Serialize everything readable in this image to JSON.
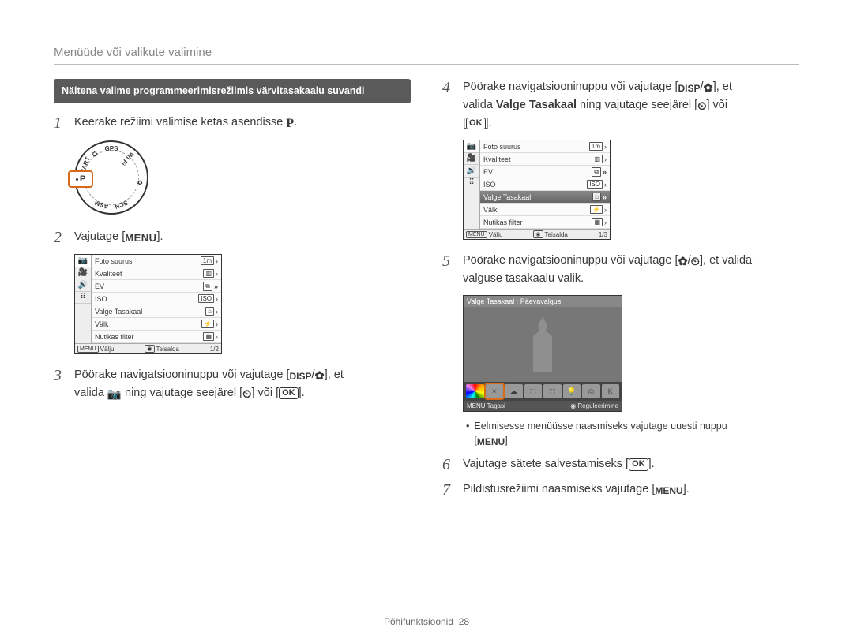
{
  "header": {
    "title": "Menüüde või valikute valimine"
  },
  "note": "Näitena valime programmeerimisrežiimis värvitasakaalu suvandi",
  "steps": {
    "s1": {
      "num": "1",
      "text_before": "Keerake režiimi valimise ketas asendisse ",
      "glyph": "P",
      "text_after": "."
    },
    "s2": {
      "num": "2",
      "text_before": "Vajutage [",
      "glyph": "MENU",
      "text_after": "]."
    },
    "s3": {
      "num": "3",
      "line1_a": "Pöörake navigatsiooninuppu või vajutage [",
      "g1": "DISP",
      "sep1": "/",
      "g2": "✿",
      "line1_b": "], et",
      "line2_a": "valida ",
      "g3": "📷",
      "line2_b": " ning vajutage seejärel [",
      "g4": "⏲",
      "line2_c": "] või [",
      "g5": "OK",
      "line2_d": "]."
    },
    "s4": {
      "num": "4",
      "line1_a": "Pöörake navigatsiooninuppu või vajutage [",
      "g1": "DISP",
      "sep1": "/",
      "g2": "✿",
      "line1_b": "], et",
      "line2_a": "valida ",
      "bold": "Valge Tasakaal",
      "line2_b": " ning vajutage seejärel [",
      "g3": "⏲",
      "line2_c": "] või",
      "line3_a": "[",
      "g4": "OK",
      "line3_b": "]."
    },
    "s5": {
      "num": "5",
      "line1_a": "Pöörake navigatsiooninuppu või vajutage [",
      "g1": "✿",
      "sep1": "/",
      "g2": "⏲",
      "line1_b": "], et valida",
      "line2": "valguse tasakaalu valik."
    },
    "s6": {
      "num": "6",
      "text_before": "Vajutage sätete salvestamiseks [",
      "glyph": "OK",
      "text_after": "]."
    },
    "s7": {
      "num": "7",
      "text_before": "Pildistusrežiimi naasmiseks vajutage [",
      "glyph": "MENU",
      "text_after": "]."
    }
  },
  "sub_bullet": {
    "text_before": "Eelmisesse menüüsse naasmiseks vajutage uuesti nuppu",
    "line2_a": "[",
    "glyph": "MENU",
    "line2_b": "]."
  },
  "dial": {
    "labels": [
      "SMART",
      "⛭",
      "GPS",
      "Wi-Fi",
      "✿",
      "SCN",
      "ASM"
    ]
  },
  "menu1": {
    "rows": [
      {
        "label": "Foto suurus",
        "icon": "1m",
        "arrow": "›"
      },
      {
        "label": "Kvaliteet",
        "icon": "▥",
        "arrow": "›"
      },
      {
        "label": "EV",
        "icon": "⧉",
        "arrow": "»",
        "big": true
      },
      {
        "label": "ISO",
        "icon": "ISO",
        "arrow": "›"
      },
      {
        "label": "Valge Tasakaal",
        "icon": "⌂",
        "arrow": "›"
      },
      {
        "label": "Välk",
        "icon": "⚡",
        "arrow": "›"
      },
      {
        "label": "Nutikas filter",
        "icon": "▦",
        "arrow": "›"
      }
    ],
    "sel_index": -1,
    "foot_left_btn": "MENU",
    "foot_left": "Välju",
    "foot_right_btn": "◉",
    "foot_right": "Teisalda",
    "page": "1/2"
  },
  "menu2": {
    "rows": [
      {
        "label": "Foto suurus",
        "icon": "1m",
        "arrow": "›"
      },
      {
        "label": "Kvaliteet",
        "icon": "▥",
        "arrow": "›"
      },
      {
        "label": "EV",
        "icon": "⧉",
        "arrow": "»",
        "big": true
      },
      {
        "label": "ISO",
        "icon": "ISO",
        "arrow": "›"
      },
      {
        "label": "Valge Tasakaal",
        "icon": "⌂",
        "arrow": "»",
        "big": true,
        "sel": true
      },
      {
        "label": "Välk",
        "icon": "⚡",
        "arrow": "›"
      },
      {
        "label": "Nutikas filter",
        "icon": "▦",
        "arrow": "›"
      }
    ],
    "foot_left_btn": "MENU",
    "foot_left": "Välju",
    "foot_right_btn": "◉",
    "foot_right": "Teisalda",
    "page": "1/3"
  },
  "preview": {
    "title": "Valge Tasakaal : Päevavalgus",
    "foot_left_btn": "MENU",
    "foot_left": "Tagasi",
    "foot_right_btn": "◉",
    "foot_right": "Reguleerimine"
  },
  "footer": {
    "section": "Põhifunktsioonid",
    "page": "28"
  },
  "tabs": [
    "📷",
    "🎥",
    "🔊",
    "⠿"
  ]
}
